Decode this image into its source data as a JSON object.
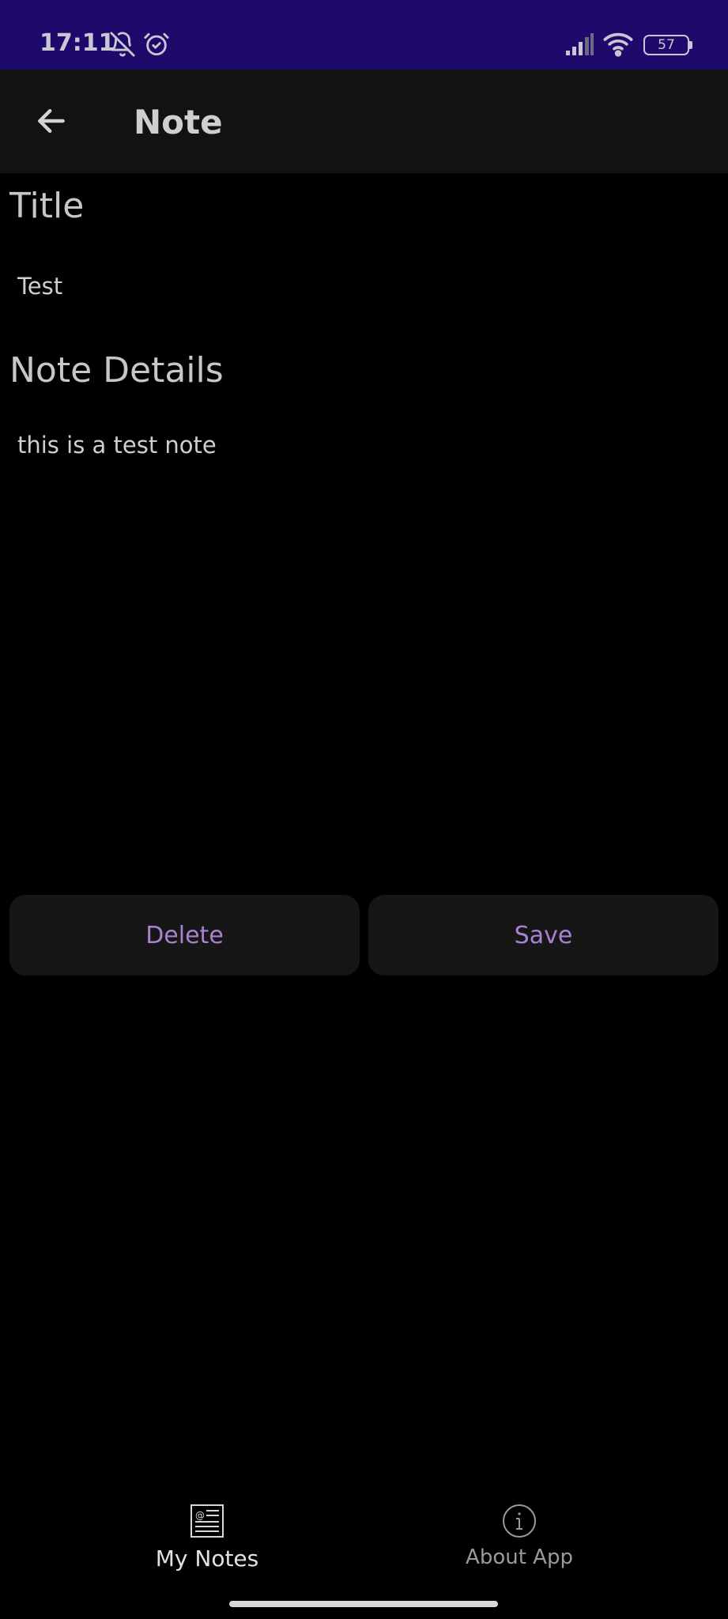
{
  "status_bar": {
    "time": "17:11",
    "battery_level": "57",
    "icons": [
      "bell-off-icon",
      "alarm-icon",
      "signal-icon",
      "wifi-icon",
      "battery-icon"
    ]
  },
  "app_bar": {
    "title": "Note",
    "back_icon": "arrow-left-icon"
  },
  "form": {
    "title_label": "Title",
    "title_value": "Test",
    "details_label": "Note Details",
    "details_value": "this is a test note"
  },
  "actions": {
    "delete_label": "Delete",
    "save_label": "Save"
  },
  "bottom_nav": {
    "items": [
      {
        "label": "My Notes",
        "icon": "notes-icon",
        "active": true
      },
      {
        "label": "About App",
        "icon": "info-icon",
        "active": false
      }
    ]
  },
  "colors": {
    "status_bar": "#1e0a6a",
    "app_bar": "#121212",
    "background": "#000000",
    "button_bg": "#161616",
    "accent": "#a981d1",
    "text": "#cfcfcf",
    "nav_inactive": "#9a9a9a"
  }
}
